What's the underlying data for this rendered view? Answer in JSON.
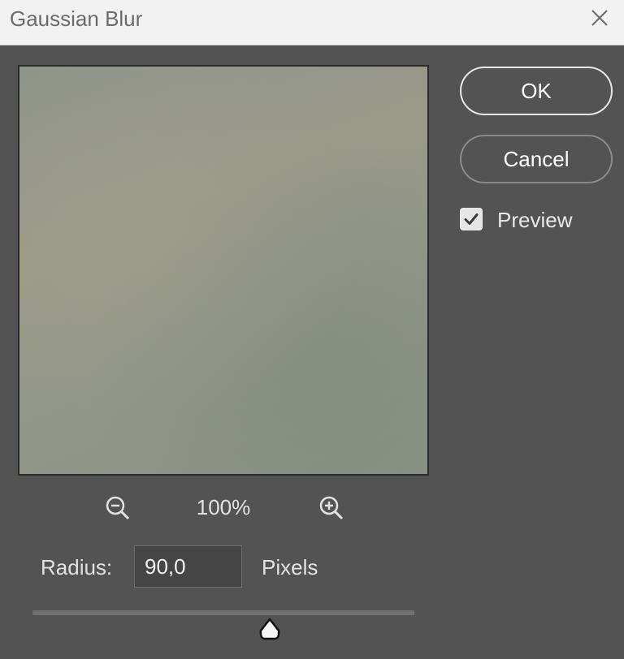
{
  "window": {
    "title": "Gaussian Blur"
  },
  "buttons": {
    "ok_label": "OK",
    "cancel_label": "Cancel"
  },
  "preview": {
    "label": "Preview",
    "checked": true
  },
  "zoom": {
    "level": "100%"
  },
  "radius": {
    "label": "Radius:",
    "value": "90,0",
    "unit": "Pixels"
  },
  "icons": {
    "close": "close-icon",
    "zoom_out": "zoom-out-icon",
    "zoom_in": "zoom-in-icon",
    "check": "checkmark-icon",
    "slider_thumb": "slider-thumb-icon"
  },
  "colors": {
    "background": "#535353",
    "titlebar": "#f2f2f2",
    "text": "#e2e2e2",
    "field": "#454545"
  }
}
